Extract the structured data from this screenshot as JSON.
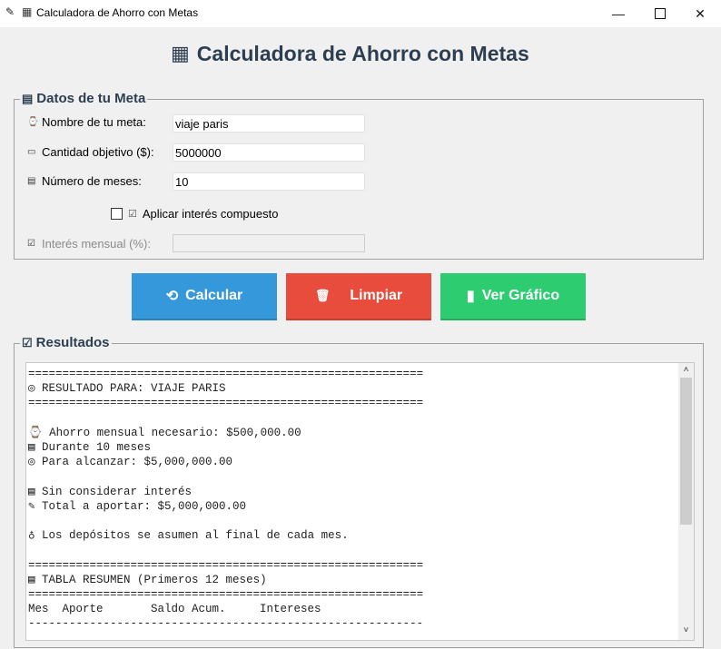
{
  "window": {
    "title": "Calculadora de Ahorro con Metas",
    "app_icon": "✎",
    "title_icon": "▦",
    "minimize": "—",
    "close": "✕"
  },
  "heading": {
    "icon": "▦",
    "text": "Calculadora de Ahorro con Metas"
  },
  "meta_group": {
    "legend_icon": "▤",
    "legend": "Datos de tu Meta",
    "fields": [
      {
        "icon": "⌚",
        "label": "Nombre de tu meta:",
        "value": "viaje paris"
      },
      {
        "icon": "▭",
        "label": "Cantidad objetivo ($):",
        "value": "5000000"
      },
      {
        "icon": "▤",
        "label": "Número de meses:",
        "value": "10"
      }
    ],
    "checkbox_icon": "☑",
    "checkbox_label": "Aplicar interés compuesto",
    "checkbox_checked": false,
    "interest_icon": "☑",
    "interest_label": "Interés mensual (%):",
    "interest_value": ""
  },
  "buttons": {
    "calc_icon": "⟲",
    "calc": "Calcular",
    "clear_icon": "🗑",
    "clear": "Limpiar",
    "chart_icon": "▮",
    "chart": "Ver Gráfico"
  },
  "results": {
    "legend_icon": "☑",
    "legend": "Resultados",
    "text": "==========================================================\n◎ RESULTADO PARA: VIAJE PARIS\n==========================================================\n\n⌚ Ahorro mensual necesario: $500,000.00\n▤ Durante 10 meses\n◎ Para alcanzar: $5,000,000.00\n\n▤ Sin considerar interés\n✎ Total a aportar: $5,000,000.00\n\n♁ Los depósitos se asumen al final de cada mes.\n\n==========================================================\n▤ TABLA RESUMEN (Primeros 12 meses)\n==========================================================\nMes  Aporte       Saldo Acum.     Intereses\n----------------------------------------------------------",
    "scroll_up": "˄",
    "scroll_down": "˅"
  }
}
